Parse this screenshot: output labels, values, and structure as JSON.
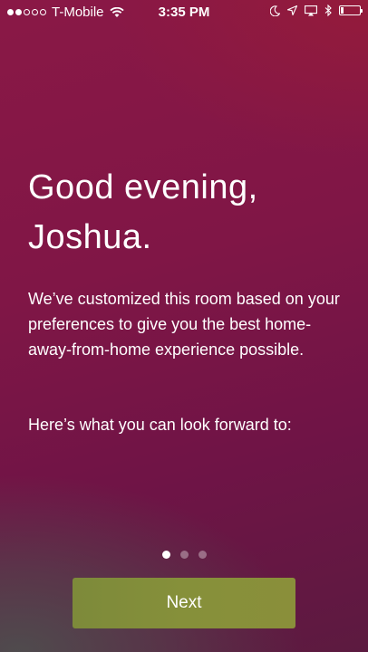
{
  "status_bar": {
    "carrier": "T-Mobile",
    "time": "3:35 PM",
    "signal_dots_filled": 2,
    "signal_dots_total": 5,
    "battery_level": 0.15,
    "icons": [
      "wifi-icon",
      "moon-icon",
      "location-arrow-icon",
      "airplay-icon",
      "bluetooth-icon",
      "battery-icon"
    ]
  },
  "main": {
    "greeting": "Good evening, Joshua.",
    "body": "We’ve customized this room based on your preferences to give you the best home-away-from-home experience possible.",
    "lead": "Here’s what you can look forward to:"
  },
  "pagination": {
    "total": 3,
    "active_index": 0
  },
  "actions": {
    "next_label": "Next"
  },
  "colors": {
    "background": "#801646",
    "button": "#86903a",
    "text": "#ffffff"
  }
}
